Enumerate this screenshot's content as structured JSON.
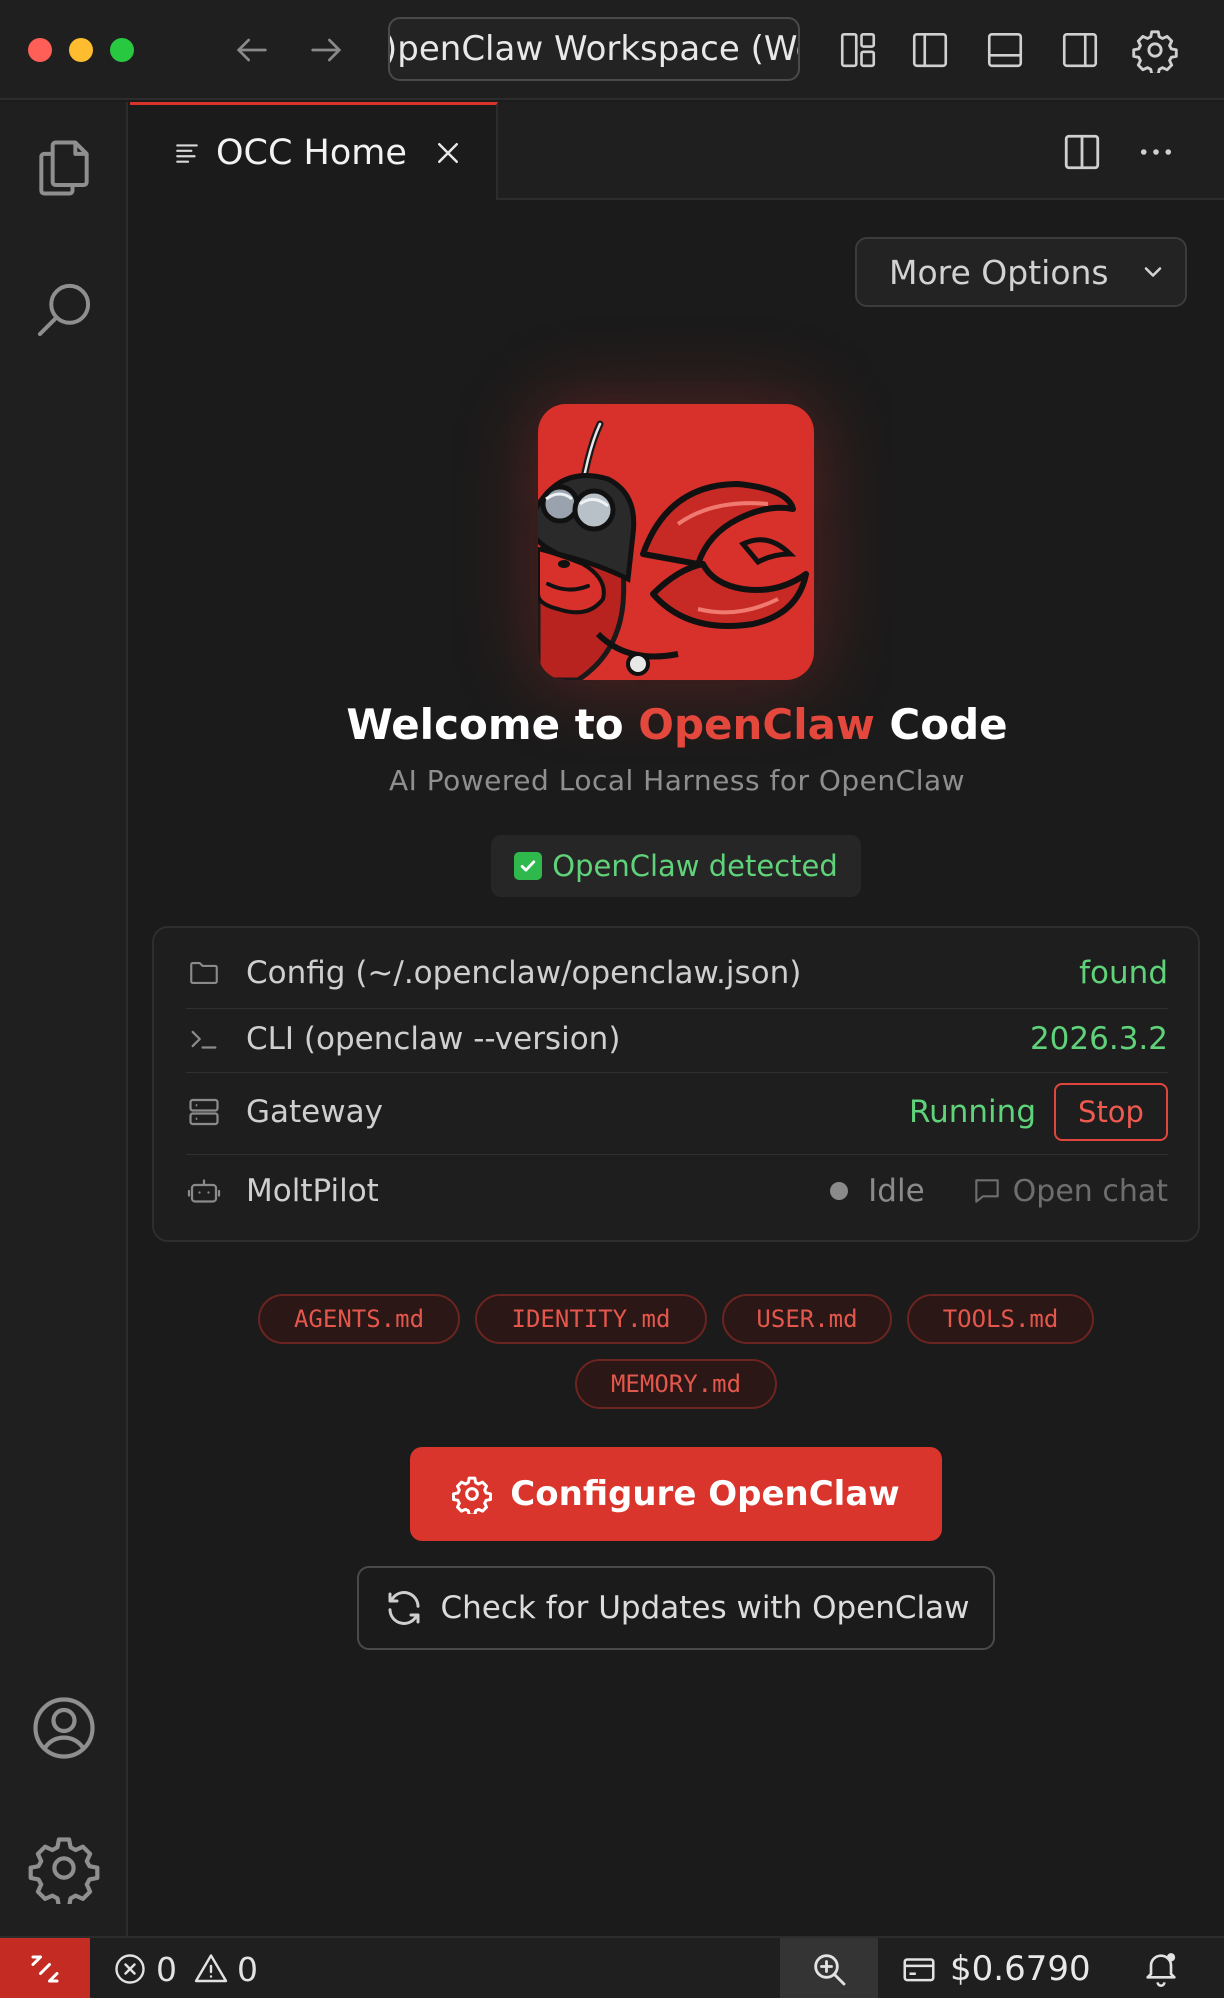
{
  "window": {
    "search_text": ")penClaw Workspace (Wo"
  },
  "editor": {
    "tab_label": "OCC Home"
  },
  "toolbar": {
    "more_options_label": "More Options"
  },
  "welcome": {
    "prefix": "Welcome to ",
    "brand": "OpenClaw",
    "suffix": " Code",
    "subtitle": "AI Powered Local Harness for OpenClaw",
    "detected_label": "OpenClaw detected"
  },
  "status_rows": {
    "config": {
      "label": "Config (~/.openclaw/openclaw.json)",
      "value": "found"
    },
    "cli": {
      "label": "CLI (openclaw --version)",
      "value": "2026.3.2"
    },
    "gateway": {
      "label": "Gateway",
      "value": "Running",
      "action": "Stop"
    },
    "moltpilot": {
      "label": "MoltPilot",
      "value": "Idle",
      "action": "Open chat"
    }
  },
  "files": [
    "AGENTS.md",
    "IDENTITY.md",
    "USER.md",
    "TOOLS.md",
    "MEMORY.md"
  ],
  "actions": {
    "configure_label": "Configure OpenClaw",
    "updates_label": "Check for Updates with OpenClaw"
  },
  "statusbar": {
    "errors": "0",
    "warnings": "0",
    "cost": "$0.6790"
  },
  "colors": {
    "accent": "#d9352c",
    "brand_text": "#e4473c",
    "success": "#5fd27a",
    "background": "#1b1b1b"
  },
  "icons": {
    "titlebar": [
      "arrow-left-icon",
      "arrow-right-icon",
      "layout-icon",
      "sidebar-left-icon",
      "panel-bottom-icon",
      "sidebar-right-icon",
      "gear-icon"
    ],
    "activity": [
      "files-icon",
      "search-icon",
      "account-icon",
      "manage-gear-icon"
    ],
    "rows": [
      "folder-icon",
      "terminal-icon",
      "server-icon",
      "robot-icon",
      "chat-bubble-icon"
    ]
  }
}
